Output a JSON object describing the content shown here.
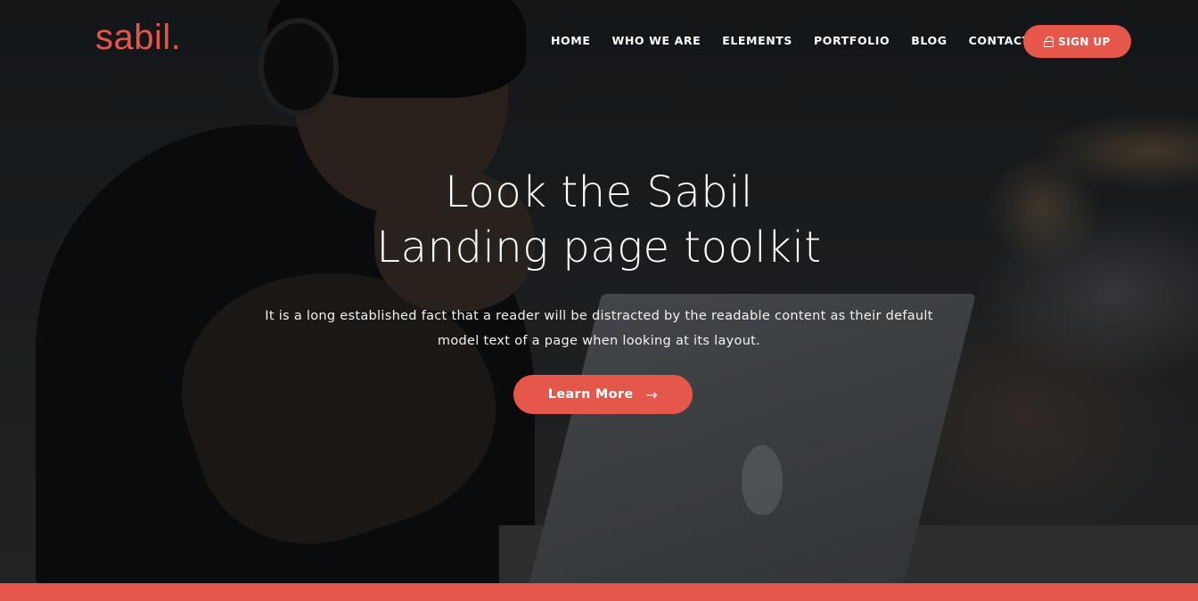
{
  "brand": {
    "logo": "sabil.",
    "accent_color": "#e5574b"
  },
  "nav": {
    "items": [
      {
        "label": "HOME"
      },
      {
        "label": "WHO WE ARE"
      },
      {
        "label": "ELEMENTS"
      },
      {
        "label": "PORTFOLIO"
      },
      {
        "label": "BLOG"
      },
      {
        "label": "CONTACT"
      }
    ],
    "signup_label": "SIGN UP",
    "signup_icon": "lock-icon"
  },
  "hero": {
    "title_line1": "Look the Sabil",
    "title_line2": "Landing page toolkit",
    "description": "It is a long established fact that a reader will be distracted by the readable content as their default model text of a page when looking at its layout.",
    "cta_label": "Learn More",
    "cta_icon": "arrow-right-icon"
  }
}
